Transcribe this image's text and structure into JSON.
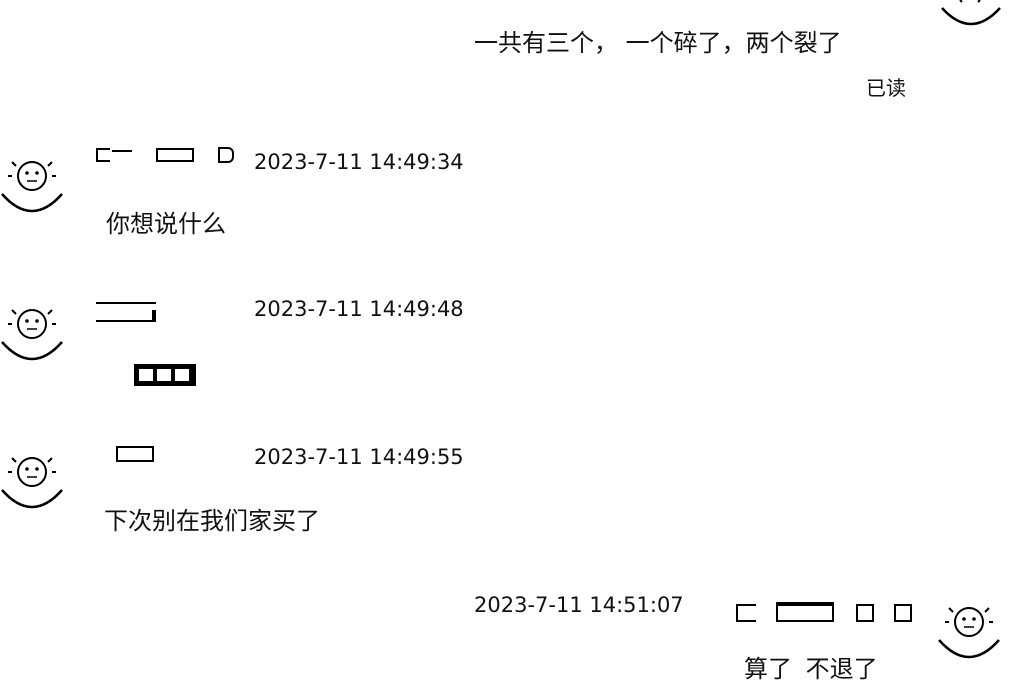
{
  "messages": [
    {
      "side": "right",
      "avatar": "avatar-icon",
      "text": "一共有三个， 一个碎了，两个裂了",
      "status": "已读"
    },
    {
      "side": "left",
      "avatar": "avatar-icon",
      "time": "2023-7-11 14:49:34",
      "text": "你想说什么"
    },
    {
      "side": "left",
      "avatar": "avatar-icon",
      "time": "2023-7-11 14:49:48",
      "text": ""
    },
    {
      "side": "left",
      "avatar": "avatar-icon",
      "time": "2023-7-11 14:49:55",
      "text": "下次别在我们家买了"
    },
    {
      "side": "right",
      "avatar": "avatar-icon",
      "time": "2023-7-11 14:51:07",
      "text": "算了 不退了"
    }
  ]
}
